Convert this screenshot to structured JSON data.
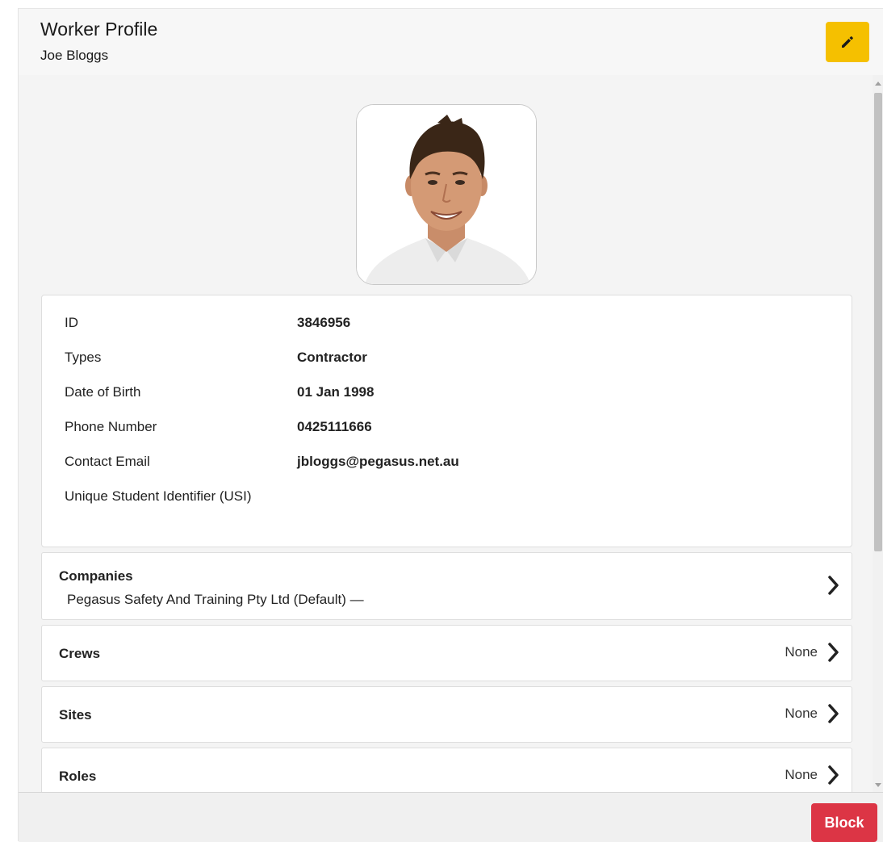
{
  "header": {
    "title": "Worker Profile",
    "subtitle": "Joe Bloggs",
    "edit_icon": "pencil-icon",
    "accent_color": "#f5c000"
  },
  "profile": {
    "photo": "worker-photo"
  },
  "details": [
    {
      "label": "ID",
      "value": "3846956"
    },
    {
      "label": "Types",
      "value": "Contractor"
    },
    {
      "label": "Date of Birth",
      "value": "01 Jan 1998"
    },
    {
      "label": "Phone Number",
      "value": "0425111666"
    },
    {
      "label": "Contact Email",
      "value": "jbloggs@pegasus.net.au"
    },
    {
      "label": "Unique Student Identifier (USI)",
      "value": ""
    }
  ],
  "sections": {
    "companies": {
      "title": "Companies",
      "sub": "Pegasus Safety And Training Pty Ltd (Default) —"
    },
    "crews": {
      "title": "Crews",
      "status": "None"
    },
    "sites": {
      "title": "Sites",
      "status": "None"
    },
    "roles": {
      "title": "Roles",
      "status": "None"
    }
  },
  "footer": {
    "block_label": "Block",
    "block_color": "#dc3545"
  }
}
